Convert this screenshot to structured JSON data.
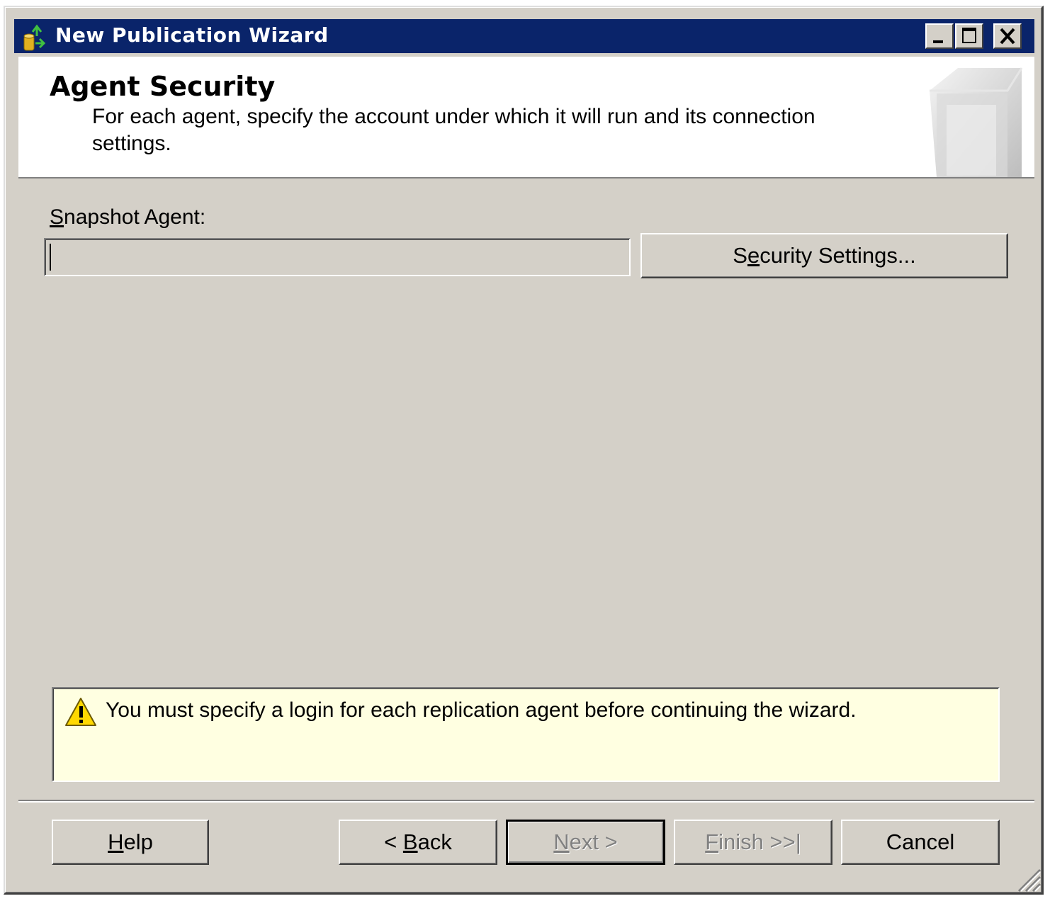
{
  "window": {
    "title": "New Publication Wizard",
    "colors": {
      "titlebar": "#0a246a",
      "face": "#d4d0c8",
      "info_background": "#ffffe1"
    }
  },
  "header": {
    "title": "Agent Security",
    "subtitle": "For each agent, specify the account under which it will run and its connection settings."
  },
  "snapshot_agent": {
    "label_accesskey": "S",
    "label_rest": "napshot Agent:",
    "value": "",
    "button_pre": "S",
    "button_accesskey": "e",
    "button_post": "curity Settings..."
  },
  "message": {
    "icon": "warning-icon",
    "text": "You must specify a login for each replication agent before continuing the wizard."
  },
  "buttons": {
    "help": {
      "accesskey": "H",
      "rest": "elp",
      "enabled": true
    },
    "back": {
      "pre": "< ",
      "accesskey": "B",
      "rest": "ack",
      "enabled": true
    },
    "next": {
      "accesskey": "N",
      "rest": "ext >",
      "enabled": false
    },
    "finish": {
      "accesskey": "F",
      "rest": "inish >>|",
      "enabled": false
    },
    "cancel": {
      "label": "Cancel",
      "enabled": true
    }
  }
}
